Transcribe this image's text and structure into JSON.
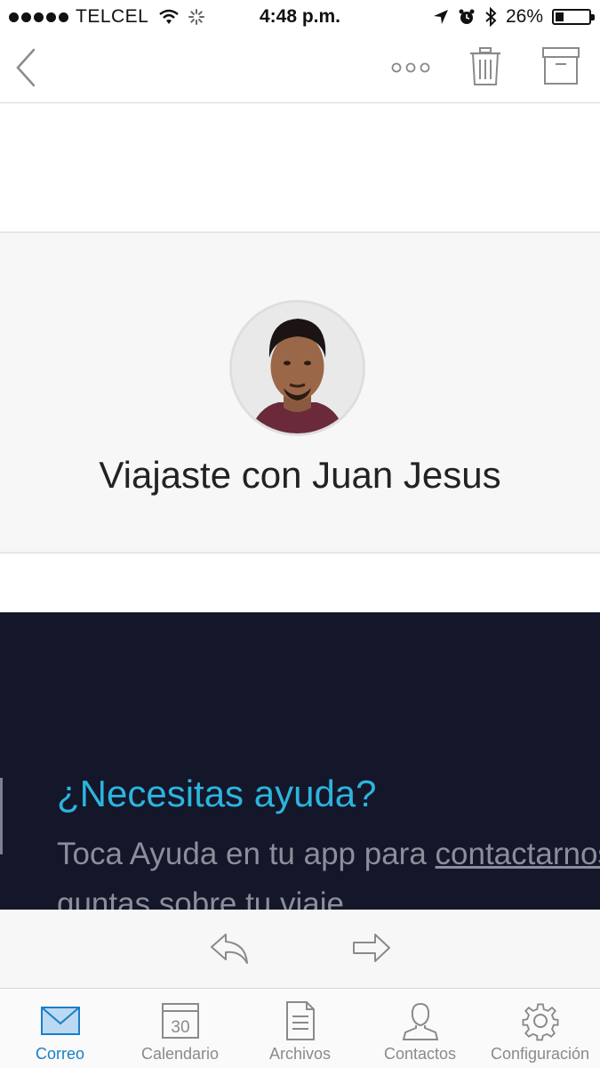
{
  "status_bar": {
    "carrier": "TELCEL",
    "time": "4:48 p.m.",
    "battery_percent": "26%",
    "battery_level": 0.26
  },
  "nav": {
    "back_icon": "chevron-left-icon",
    "more_icon": "ellipsis-icon",
    "delete_icon": "trash-icon",
    "archive_icon": "archive-box-icon"
  },
  "email": {
    "trip_title": "Viajaste con Juan Jesus",
    "help_title": "¿Necesitas ayuda?",
    "help_text_before_link": "Toca Ayuda en tu app para ",
    "help_link": "contactarnos",
    "help_text_line2": "guntas sobre tu viaje."
  },
  "actions": {
    "reply_icon": "reply-arrow-icon",
    "forward_icon": "forward-arrow-icon"
  },
  "tab_bar": {
    "tabs": [
      {
        "label": "Correo",
        "icon": "envelope-icon",
        "active": true
      },
      {
        "label": "Calendario",
        "icon": "calendar-icon",
        "active": false,
        "day": "30"
      },
      {
        "label": "Archivos",
        "icon": "document-icon",
        "active": false
      },
      {
        "label": "Contactos",
        "icon": "person-icon",
        "active": false
      },
      {
        "label": "Configuración",
        "icon": "gear-icon",
        "active": false
      }
    ]
  },
  "colors": {
    "accent": "#1a7fc8",
    "help_title": "#2cb4de",
    "help_background": "#141629"
  }
}
